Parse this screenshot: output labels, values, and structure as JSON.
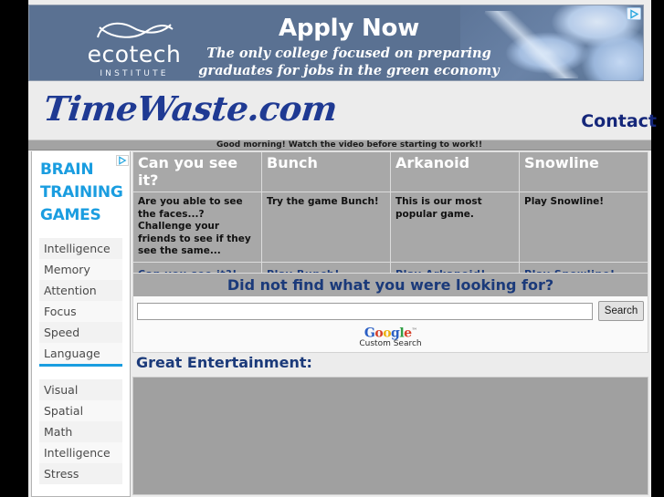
{
  "ad": {
    "brand_name": "ecotech",
    "brand_sub": "INSTITUTE",
    "headline": "Apply Now",
    "subline": "The only college focused on preparing graduates for jobs in the green economy",
    "adchoices_icon": "adchoices-icon",
    "background_color": "#5a7192"
  },
  "site": {
    "title": "TimeWaste.com",
    "contact_label": "Contact",
    "title_color": "#1f3a93"
  },
  "ticker": {
    "message": "Good morning! Watch the video before starting to work!!"
  },
  "sidebar": {
    "title": "BRAIN TRAINING GAMES",
    "title_color": "#1a9de0",
    "adchoices_icon": "adchoices-icon",
    "group_one": [
      "Intelligence",
      "Memory",
      "Attention",
      "Focus",
      "Speed",
      "Language"
    ],
    "group_two": [
      "Visual",
      "Spatial",
      "Math",
      "Intelligence",
      "Stress"
    ]
  },
  "games": {
    "columns": [
      {
        "title": "Can you see it?",
        "description": "Are you able to see the faces...? Challenge your friends to see if they see the same...",
        "link": "Can you see it?!"
      },
      {
        "title": "Bunch",
        "description": "Try the game Bunch!",
        "link": "Play Bunch!"
      },
      {
        "title": "Arkanoid",
        "description": "This is our most popular game.",
        "link": "Play Arkanoid!"
      },
      {
        "title": "Snowline",
        "description": "Play Snowline!",
        "link": "Play Snowline!"
      }
    ]
  },
  "search": {
    "heading": "Did not find what you were looking for?",
    "input_value": "",
    "input_placeholder": "",
    "button_label": "Search",
    "branding_caption": "Custom Search",
    "branding_tm": "™"
  },
  "entertainment": {
    "title": "Great Entertainment:"
  }
}
